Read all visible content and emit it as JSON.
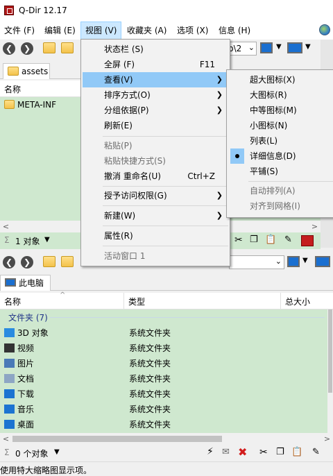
{
  "app": {
    "title": "Q-Dir 12.17"
  },
  "menubar": [
    {
      "label": "文件 (F)"
    },
    {
      "label": "编辑 (E)"
    },
    {
      "label": "视图 (V)"
    },
    {
      "label": "收藏夹 (A)"
    },
    {
      "label": "选项 (X)"
    },
    {
      "label": "信息 (H)"
    }
  ],
  "top_pane": {
    "address_fragment": "p\\2",
    "tab": "assets",
    "column_name": "名称",
    "items": [
      {
        "name": "META-INF"
      }
    ],
    "status": "1 对象"
  },
  "bottom_pane": {
    "tab": "此电脑",
    "columns": {
      "name": "名称",
      "type": "类型",
      "size": "总大小"
    },
    "group": "文件夹 (7)",
    "items": [
      {
        "name": "3D 对象",
        "type": "系统文件夹",
        "icon": "3d-objects-icon",
        "color": "#2a8be0"
      },
      {
        "name": "视频",
        "type": "系统文件夹",
        "icon": "video-icon",
        "color": "#333333"
      },
      {
        "name": "图片",
        "type": "系统文件夹",
        "icon": "pictures-icon",
        "color": "#4a7ab7"
      },
      {
        "name": "文档",
        "type": "系统文件夹",
        "icon": "documents-icon",
        "color": "#8da6c4"
      },
      {
        "name": "下载",
        "type": "系统文件夹",
        "icon": "download-icon",
        "color": "#1c74d1"
      },
      {
        "name": "音乐",
        "type": "系统文件夹",
        "icon": "music-icon",
        "color": "#1c74d1"
      },
      {
        "name": "桌面",
        "type": "系统文件夹",
        "icon": "desktop-icon",
        "color": "#1c74d1"
      }
    ],
    "status": "0 个对象"
  },
  "view_menu": {
    "items": [
      {
        "label": "状态栏 (S)",
        "shortcut": ""
      },
      {
        "label": "全屏 (F)",
        "shortcut": "F11"
      },
      {
        "label": "查看(V)",
        "shortcut": "",
        "submenu": true
      },
      {
        "label": "排序方式(O)",
        "shortcut": "",
        "submenu": true
      },
      {
        "label": "分组依据(P)",
        "shortcut": "",
        "submenu": true
      },
      {
        "label": "刷新(E)",
        "shortcut": ""
      },
      {
        "label": "粘贴(P)",
        "shortcut": ""
      },
      {
        "label": "粘贴快捷方式(S)",
        "shortcut": ""
      },
      {
        "label": "撤消 重命名(U)",
        "shortcut": "Ctrl+Z"
      },
      {
        "label": "授予访问权限(G)",
        "shortcut": "",
        "submenu": true
      },
      {
        "label": "新建(W)",
        "shortcut": "",
        "submenu": true
      },
      {
        "label": "属性(R)",
        "shortcut": ""
      },
      {
        "label": "活动窗口 1",
        "shortcut": ""
      }
    ]
  },
  "view_submenu": {
    "items": [
      {
        "label": "超大图标(X)"
      },
      {
        "label": "大图标(R)"
      },
      {
        "label": "中等图标(M)"
      },
      {
        "label": "小图标(N)"
      },
      {
        "label": "列表(L)"
      },
      {
        "label": "详细信息(D)",
        "selected": true
      },
      {
        "label": "平铺(S)"
      },
      {
        "label": "自动排列(A)"
      },
      {
        "label": "对齐到网格(I)"
      }
    ]
  },
  "status_hint": "使用特大缩略图显示项。"
}
